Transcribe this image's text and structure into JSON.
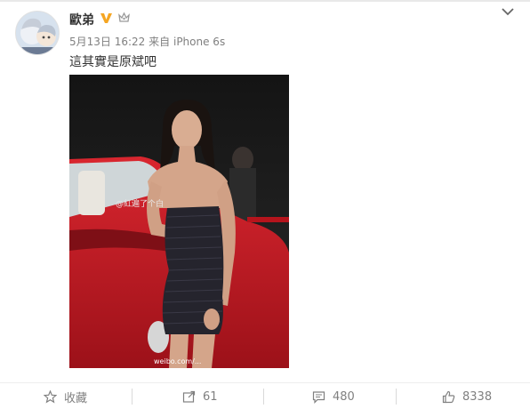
{
  "post": {
    "username": "歐弟",
    "date": "5月13日 16:22",
    "source_prefix": "来自",
    "source": "iPhone 6s",
    "text": "這其實是原斌吧",
    "image_watermark": "@紅遍了个白",
    "image_footer": "weibo.com/..."
  },
  "actions": {
    "favorite": "收藏",
    "repost": "61",
    "comment": "480",
    "like": "8338"
  },
  "colors": {
    "verified": "#f5a623",
    "meta": "#808080",
    "text": "#333333",
    "car_red": "#c81e28"
  }
}
